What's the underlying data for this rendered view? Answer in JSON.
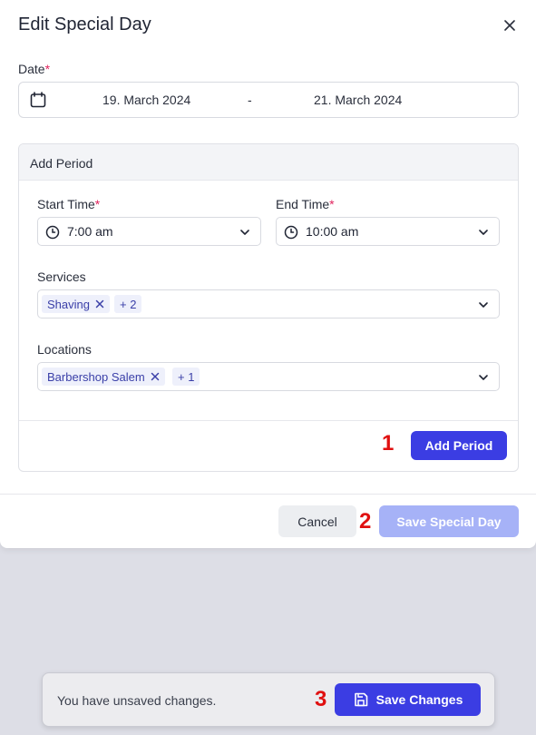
{
  "modal": {
    "title": "Edit Special Day"
  },
  "date": {
    "label": "Date",
    "required_mark": "*",
    "start": "19. March 2024",
    "separator": "-",
    "end": "21. March 2024"
  },
  "period": {
    "header": "Add Period",
    "start_time": {
      "label": "Start Time",
      "required_mark": "*",
      "value": "7:00 am"
    },
    "end_time": {
      "label": "End Time",
      "required_mark": "*",
      "value": "10:00 am"
    },
    "services": {
      "label": "Services",
      "tags": [
        "Shaving"
      ],
      "more": "+ 2"
    },
    "locations": {
      "label": "Locations",
      "tags": [
        "Barbershop Salem"
      ],
      "more": "+ 1"
    },
    "add_button": "Add Period"
  },
  "footer": {
    "cancel": "Cancel",
    "save": "Save Special Day"
  },
  "toast": {
    "message": "You have unsaved changes.",
    "save_button": "Save Changes"
  },
  "annotations": [
    "1",
    "2",
    "3"
  ],
  "colors": {
    "primary": "#3b3de3",
    "primary_disabled": "#a6b2f7",
    "required": "#e0245e",
    "annotation": "#e01010"
  }
}
